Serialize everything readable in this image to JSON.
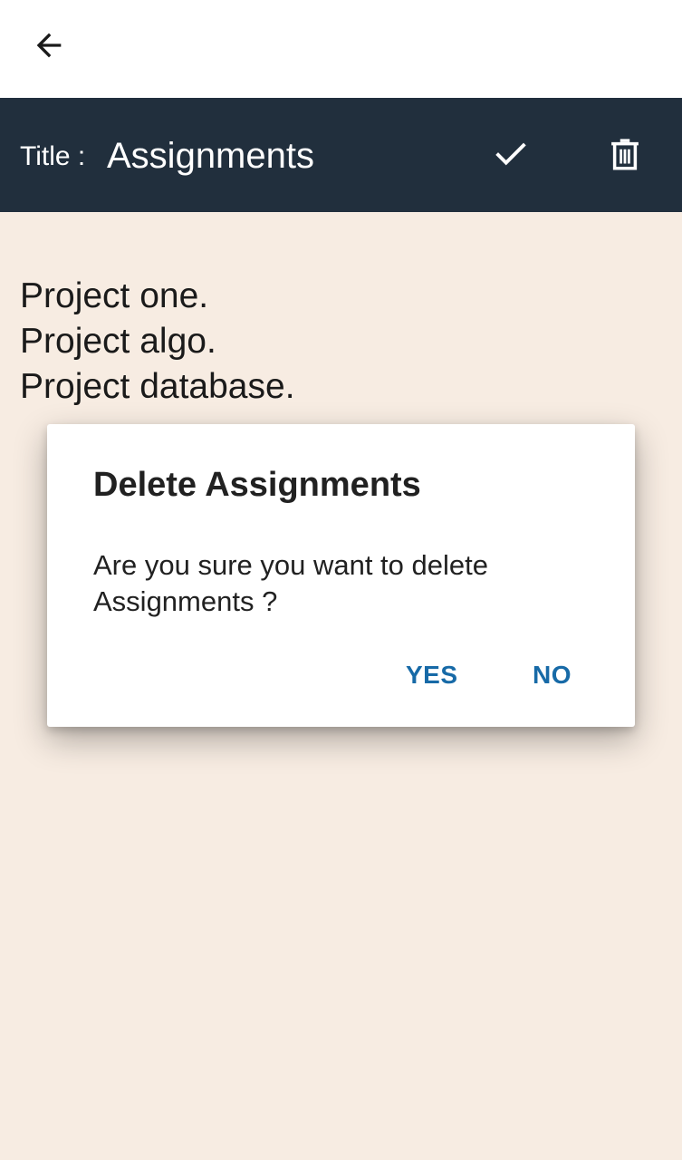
{
  "app_bar": {
    "back_icon": "arrow-left-icon"
  },
  "title_bar": {
    "label": "Title :",
    "value": "Assignments",
    "save_icon": "check-icon",
    "delete_icon": "trash-icon",
    "background_color": "#212f3d"
  },
  "note": {
    "lines": [
      "Project one.",
      "Project algo.",
      "Project database."
    ],
    "background_color": "#f7ece2"
  },
  "dialog": {
    "title": "Delete Assignments",
    "message": "Are you sure you want to delete Assignments ?",
    "yes_label": "YES",
    "no_label": "NO",
    "button_color": "#176aa7"
  }
}
